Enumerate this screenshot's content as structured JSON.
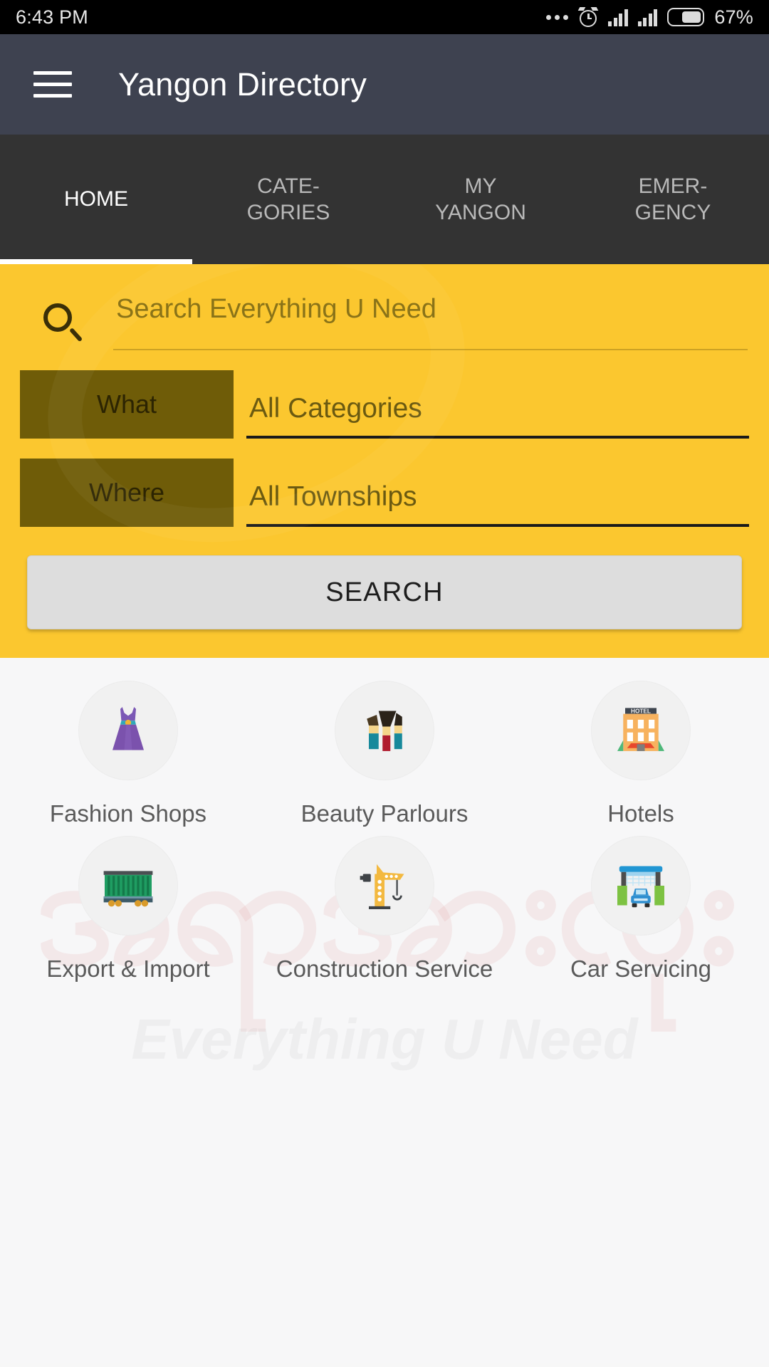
{
  "status_bar": {
    "time": "6:43 PM",
    "battery_percent": "67%",
    "icons": [
      "more-dots-icon",
      "alarm-icon",
      "signal-bars-icon",
      "signal-bars-icon",
      "battery-icon"
    ]
  },
  "app_bar": {
    "menu_icon": "hamburger-menu-icon",
    "title": "Yangon Directory"
  },
  "tabs": [
    {
      "label": "HOME",
      "active": true
    },
    {
      "label": "CATE-\nGORIES",
      "active": false
    },
    {
      "label": "MY\nYANGON",
      "active": false
    },
    {
      "label": "EMER-\nGENCY",
      "active": false
    }
  ],
  "search_panel": {
    "accent_color": "#fbc72f",
    "search_icon": "magnifier-icon",
    "search_placeholder": "Search Everything U Need",
    "search_value": "",
    "what": {
      "label": "What",
      "value": "All Categories"
    },
    "where": {
      "label": "Where",
      "value": "All Townships"
    },
    "search_button": "SEARCH"
  },
  "watermarks": {
    "burmese": "အရာအားလုံး",
    "tagline": "Everything U Need"
  },
  "categories": [
    {
      "label": "Fashion Shops",
      "icon": "dress-icon"
    },
    {
      "label": "Beauty Parlours",
      "icon": "makeup-brushes-icon"
    },
    {
      "label": "Hotels",
      "icon": "hotel-building-icon"
    },
    {
      "label": "Export & Import",
      "icon": "shipping-container-icon"
    },
    {
      "label": "Construction Service",
      "icon": "tower-crane-icon"
    },
    {
      "label": "Car Servicing",
      "icon": "car-wash-icon"
    }
  ]
}
